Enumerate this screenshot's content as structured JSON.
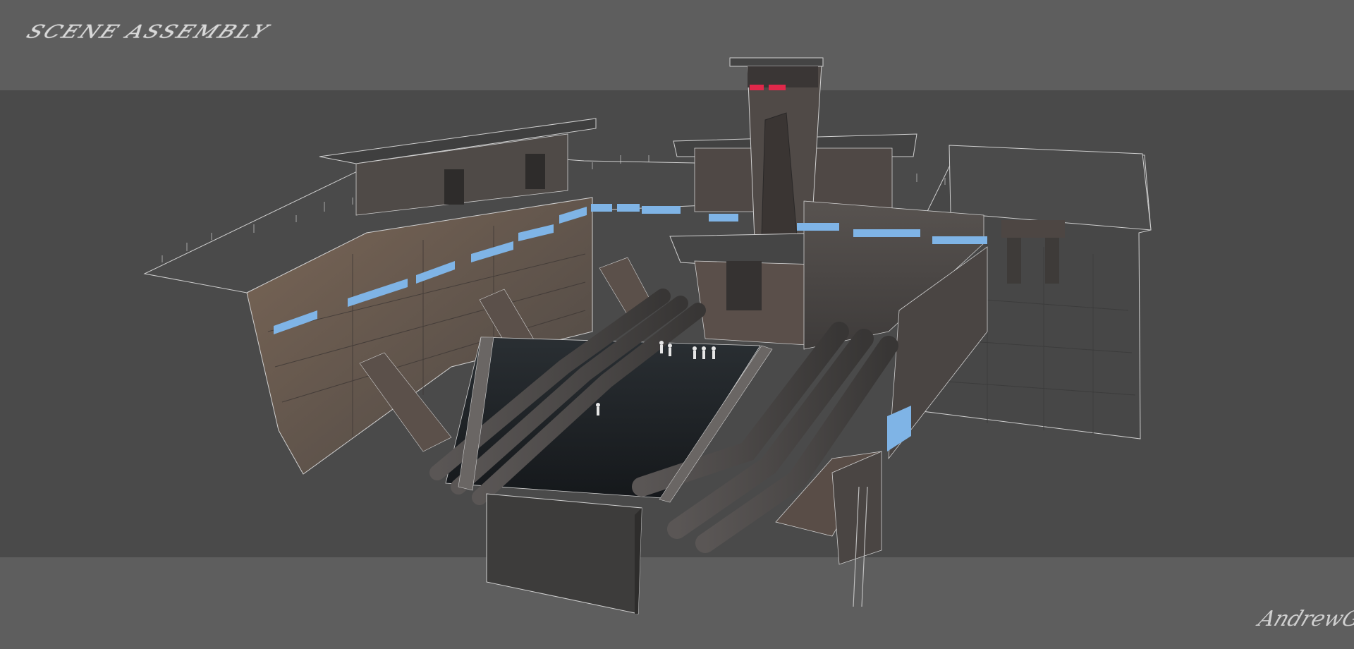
{
  "title_mark": "Scene Assembly",
  "signature": "AndrewG",
  "colors": {
    "background_light": "#5e5e5e",
    "background_dark": "#4a4a4a",
    "structure": "#4e4a48",
    "structure_lit": "#6e5e52",
    "roof": "#444444",
    "window_glow": "#7fb4e6",
    "tower_light": "#e0284a",
    "water": "#1e2124",
    "outline": "#d0d0d0"
  },
  "icons": {
    "tower_beacon": "red-beacon",
    "figures": "trooper-figures"
  }
}
